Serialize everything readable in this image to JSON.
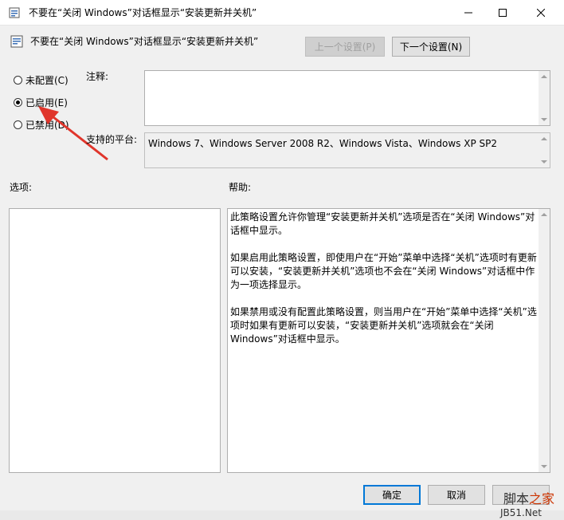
{
  "window": {
    "title": "不要在“关闭 Windows”对话框显示“安装更新并关机”"
  },
  "header": {
    "policy_title": "不要在“关闭 Windows”对话框显示“安装更新并关机”",
    "prev_setting": "上一个设置(P)",
    "next_setting": "下一个设置(N)"
  },
  "radios": [
    {
      "label": "未配置(C)",
      "checked": false
    },
    {
      "label": "已启用(E)",
      "checked": true
    },
    {
      "label": "已禁用(D)",
      "checked": false
    }
  ],
  "comment": {
    "label": "注释:",
    "value": ""
  },
  "platform": {
    "label": "支持的平台:",
    "value": "Windows 7、Windows Server 2008 R2、Windows Vista、Windows XP SP2"
  },
  "options": {
    "label": "选项:"
  },
  "help": {
    "label": "帮助:",
    "paragraphs": [
      "此策略设置允许你管理“安装更新并关机”选项是否在“关闭 Windows”对话框中显示。",
      "如果启用此策略设置，即使用户在“开始”菜单中选择“关机”选项时有更新可以安装，“安装更新并关机”选项也不会在“关闭 Windows”对话框中作为一项选择显示。",
      "如果禁用或没有配置此策略设置，则当用户在“开始”菜单中选择“关机”选项时如果有更新可以安装，“安装更新并关机”选项就会在“关闭 Windows”对话框中显示。"
    ]
  },
  "footer": {
    "ok": "确定",
    "cancel": "取消"
  },
  "watermark": {
    "line1_a": "脚本",
    "line1_b": "之家",
    "line2": "JB51.Net"
  },
  "colors": {
    "accent": "#0078d7",
    "arrow": "#e0352b"
  }
}
